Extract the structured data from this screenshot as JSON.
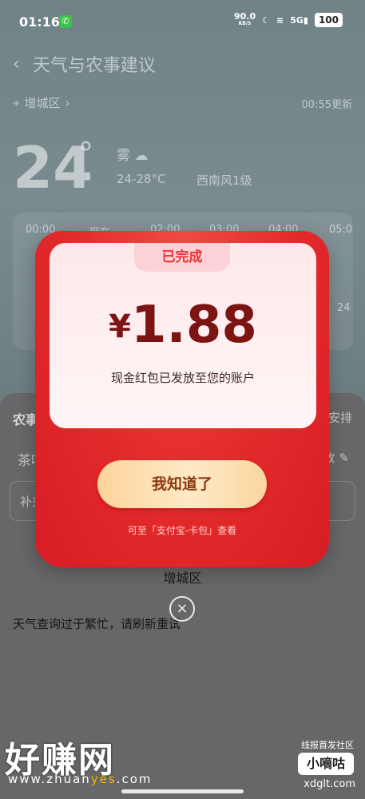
{
  "status_bar": {
    "time": "01:16",
    "speed": "90.0",
    "speed_unit": "KB/S",
    "network": "5G",
    "battery": "100"
  },
  "page": {
    "title": "天气与农事建议",
    "location": "增城区",
    "updated": "00:55更新",
    "temperature": "24",
    "degree_symbol": "°",
    "condition": "雾",
    "range": "24-28°C",
    "wind": "西南风1级",
    "hourly": [
      {
        "time": "00:00"
      },
      {
        "time": "现在"
      },
      {
        "time": "02:00"
      },
      {
        "time": "03:00"
      },
      {
        "time": "04:00"
      },
      {
        "time": "05:0"
      }
    ],
    "hourly_temp_right": "24",
    "farming_title": "农事",
    "farming_arrange": "安排",
    "crop": "茶叶",
    "crop_edit": "改",
    "advice_prefix": "补充",
    "location_bottom": "增城区",
    "error_text": "天气查询过于繁忙，请刷新重试"
  },
  "modal": {
    "badge": "已完成",
    "currency": "¥",
    "amount": "1.88",
    "message": "现金红包已发放至您的账户",
    "button": "我知道了",
    "hint": "可至「支付宝-卡包」查看",
    "close_symbol": "×"
  },
  "watermark": {
    "logo": "好赚网",
    "url_prefix": "www.zhuan",
    "url_highlight": "yes",
    "url_suffix": ".com",
    "right_top": "线报首发社区",
    "right_box": "小嘀咕",
    "right_url": "xdglt.com"
  }
}
